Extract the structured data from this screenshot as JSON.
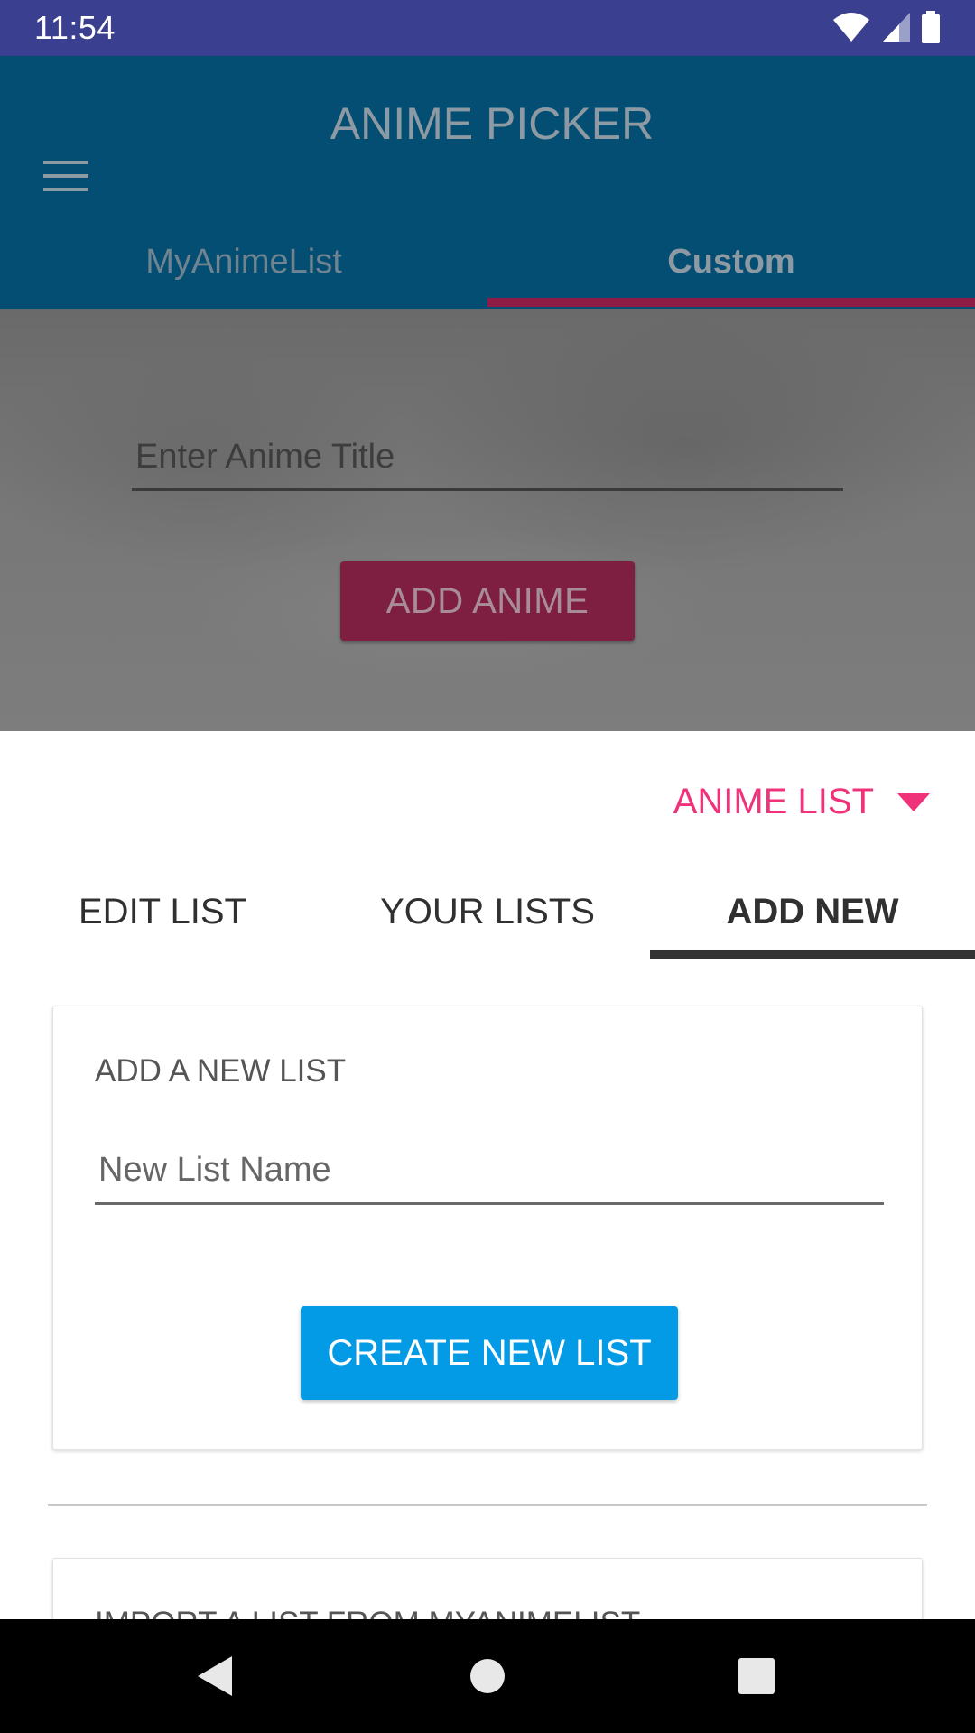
{
  "status_bar": {
    "time": "11:54",
    "icons": [
      "wifi-icon",
      "cell-signal-icon",
      "battery-icon"
    ]
  },
  "app_bar": {
    "menu_icon": "hamburger-menu-icon",
    "title": "ANIME PICKER",
    "tabs": [
      {
        "label": "MyAnimeList",
        "selected": false
      },
      {
        "label": "Custom",
        "selected": true
      }
    ]
  },
  "hero": {
    "anime_input_placeholder": "Enter Anime Title",
    "add_button_label": "ADD ANIME"
  },
  "list_selector": {
    "selected": "ANIME LIST",
    "caret_icon": "caret-down-icon"
  },
  "sub_tabs": [
    {
      "label": "EDIT LIST",
      "selected": false
    },
    {
      "label": "YOUR LISTS",
      "selected": false
    },
    {
      "label": "ADD NEW",
      "selected": true
    }
  ],
  "add_list_card": {
    "title": "ADD A NEW LIST",
    "name_placeholder": "New List Name",
    "create_button_label": "CREATE NEW LIST"
  },
  "import_card": {
    "title": "IMPORT A LIST FROM MYANIMELIST"
  },
  "colors": {
    "status_bar": "#3b3f8f",
    "app_bar": "#034e72",
    "accent_pink": "#f0327a",
    "tab_indicator": "#8d1d44",
    "create_button": "#039be5"
  },
  "nav_bar": {
    "buttons": [
      "back-icon",
      "home-icon",
      "recent-apps-icon"
    ]
  }
}
